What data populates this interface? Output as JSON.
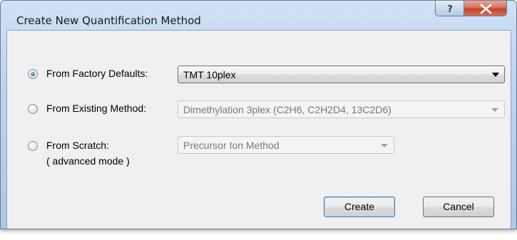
{
  "window": {
    "title": "Create New Quantification Method",
    "help_icon": "help-icon",
    "close_icon": "close-icon"
  },
  "options": [
    {
      "label": "From Factory Defaults:",
      "selected": true,
      "combo_value": "TMT 10plex",
      "combo_enabled": true
    },
    {
      "label": "From Existing Method:",
      "selected": false,
      "combo_value": "Dimethylation 3plex (C2H6, C2H2D4, 13C2D6)",
      "combo_enabled": false
    },
    {
      "label": "From Scratch:",
      "sublabel": "( advanced mode )",
      "selected": false,
      "combo_value": "Precursor Ion Method",
      "combo_enabled": false
    }
  ],
  "buttons": {
    "create_label": "Create",
    "cancel_label": "Cancel"
  },
  "colors": {
    "title_bar": "#bcd3ee",
    "close_button": "#c5432b",
    "radio_selected": "#2a7fc9",
    "default_button_border": "#3c7fb1"
  }
}
